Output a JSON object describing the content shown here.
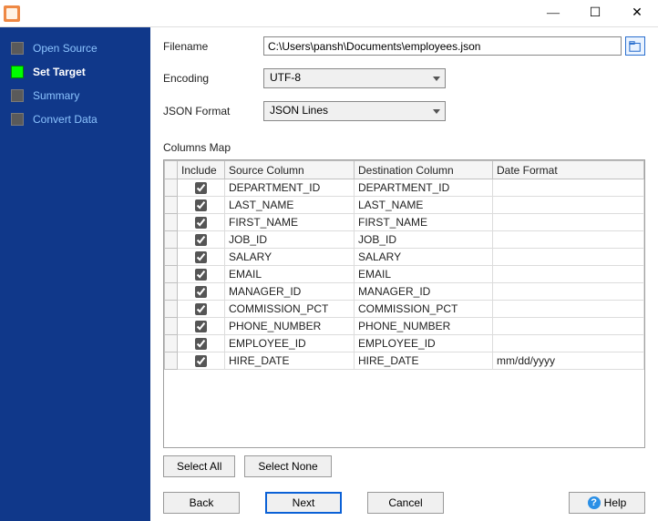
{
  "window": {
    "minimize_glyph": "—",
    "maximize_glyph": "☐",
    "close_glyph": "✕"
  },
  "sidebar": {
    "items": [
      {
        "label": "Open Source",
        "active": false
      },
      {
        "label": "Set Target",
        "active": true
      },
      {
        "label": "Summary",
        "active": false
      },
      {
        "label": "Convert Data",
        "active": false
      }
    ]
  },
  "form": {
    "filename_label": "Filename",
    "filename_value": "C:\\Users\\pansh\\Documents\\employees.json",
    "encoding_label": "Encoding",
    "encoding_value": "UTF-8",
    "format_label": "JSON Format",
    "format_value": "JSON Lines"
  },
  "columns": {
    "title": "Columns Map",
    "headers": {
      "include": "Include",
      "source": "Source Column",
      "destination": "Destination Column",
      "date_format": "Date Format"
    },
    "rows": [
      {
        "include": true,
        "src": "DEPARTMENT_ID",
        "dst": "DEPARTMENT_ID",
        "fmt": ""
      },
      {
        "include": true,
        "src": "LAST_NAME",
        "dst": "LAST_NAME",
        "fmt": ""
      },
      {
        "include": true,
        "src": "FIRST_NAME",
        "dst": "FIRST_NAME",
        "fmt": ""
      },
      {
        "include": true,
        "src": "JOB_ID",
        "dst": "JOB_ID",
        "fmt": ""
      },
      {
        "include": true,
        "src": "SALARY",
        "dst": "SALARY",
        "fmt": ""
      },
      {
        "include": true,
        "src": "EMAIL",
        "dst": "EMAIL",
        "fmt": ""
      },
      {
        "include": true,
        "src": "MANAGER_ID",
        "dst": "MANAGER_ID",
        "fmt": ""
      },
      {
        "include": true,
        "src": "COMMISSION_PCT",
        "dst": "COMMISSION_PCT",
        "fmt": ""
      },
      {
        "include": true,
        "src": "PHONE_NUMBER",
        "dst": "PHONE_NUMBER",
        "fmt": ""
      },
      {
        "include": true,
        "src": "EMPLOYEE_ID",
        "dst": "EMPLOYEE_ID",
        "fmt": ""
      },
      {
        "include": true,
        "src": "HIRE_DATE",
        "dst": "HIRE_DATE",
        "fmt": "mm/dd/yyyy"
      }
    ]
  },
  "buttons": {
    "select_all": "Select All",
    "select_none": "Select None",
    "back": "Back",
    "next": "Next",
    "cancel": "Cancel",
    "help": "Help"
  }
}
